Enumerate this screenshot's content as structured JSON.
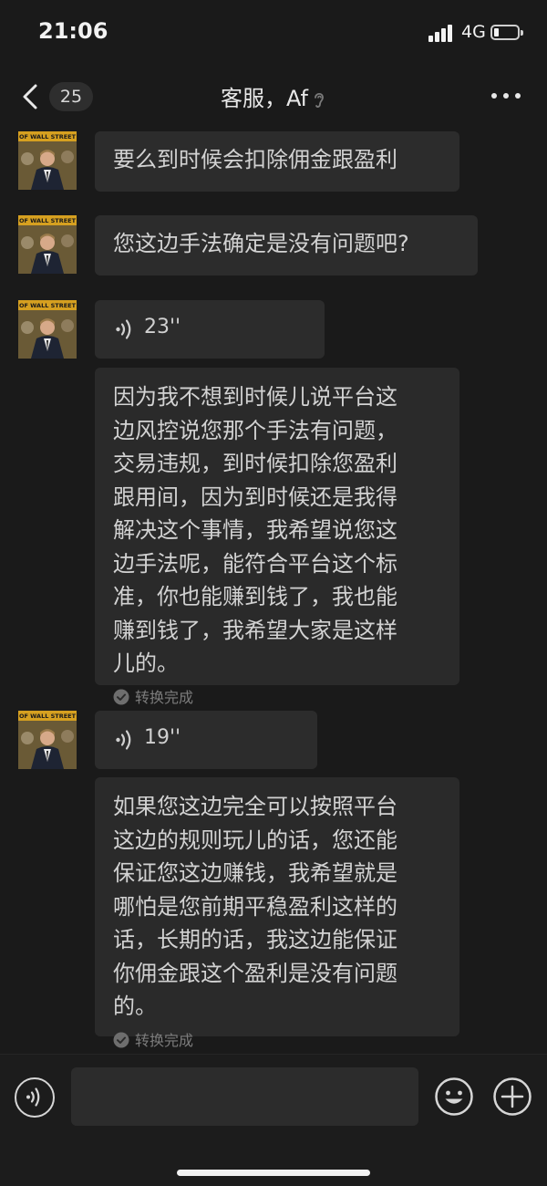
{
  "status_bar": {
    "time": "21:06",
    "network": "4G"
  },
  "nav": {
    "back_count": "25",
    "title": "客服，Af"
  },
  "messages": [
    {
      "type": "text",
      "text": "要么到时候会扣除佣金跟盈利"
    },
    {
      "type": "text",
      "text": "您这边手法确定是没有问题吧?"
    },
    {
      "type": "voice",
      "duration": "23''",
      "transcript_lines": [
        "因为我不想到时候儿说平台这",
        "边风控说您那个手法有问题，",
        "交易违规，到时候扣除您盈利",
        "跟用间，因为到时候还是我得",
        "解决这个事情，我希望说您这",
        "边手法呢，能符合平台这个标",
        "准，你也能赚到钱了，我也能",
        "赚到钱了，我希望大家是这样",
        "儿的。"
      ],
      "status": "转换完成"
    },
    {
      "type": "voice",
      "duration": "19''",
      "transcript_lines": [
        "如果您这边完全可以按照平台",
        "这边的规则玩儿的话，您还能",
        "保证您这边赚钱，我希望就是",
        "哪怕是您前期平稳盈利这样的",
        "话，长期的话，我这边能保证",
        "你佣金跟这个盈利是没有问题",
        "的。"
      ],
      "status": "转换完成"
    }
  ],
  "avatar_banner": "OF WALL STREET",
  "colors": {
    "background": "#1a1a1a",
    "bubble": "#2c2c2c",
    "text": "#d2d2d2",
    "muted": "#7c7c7c"
  }
}
